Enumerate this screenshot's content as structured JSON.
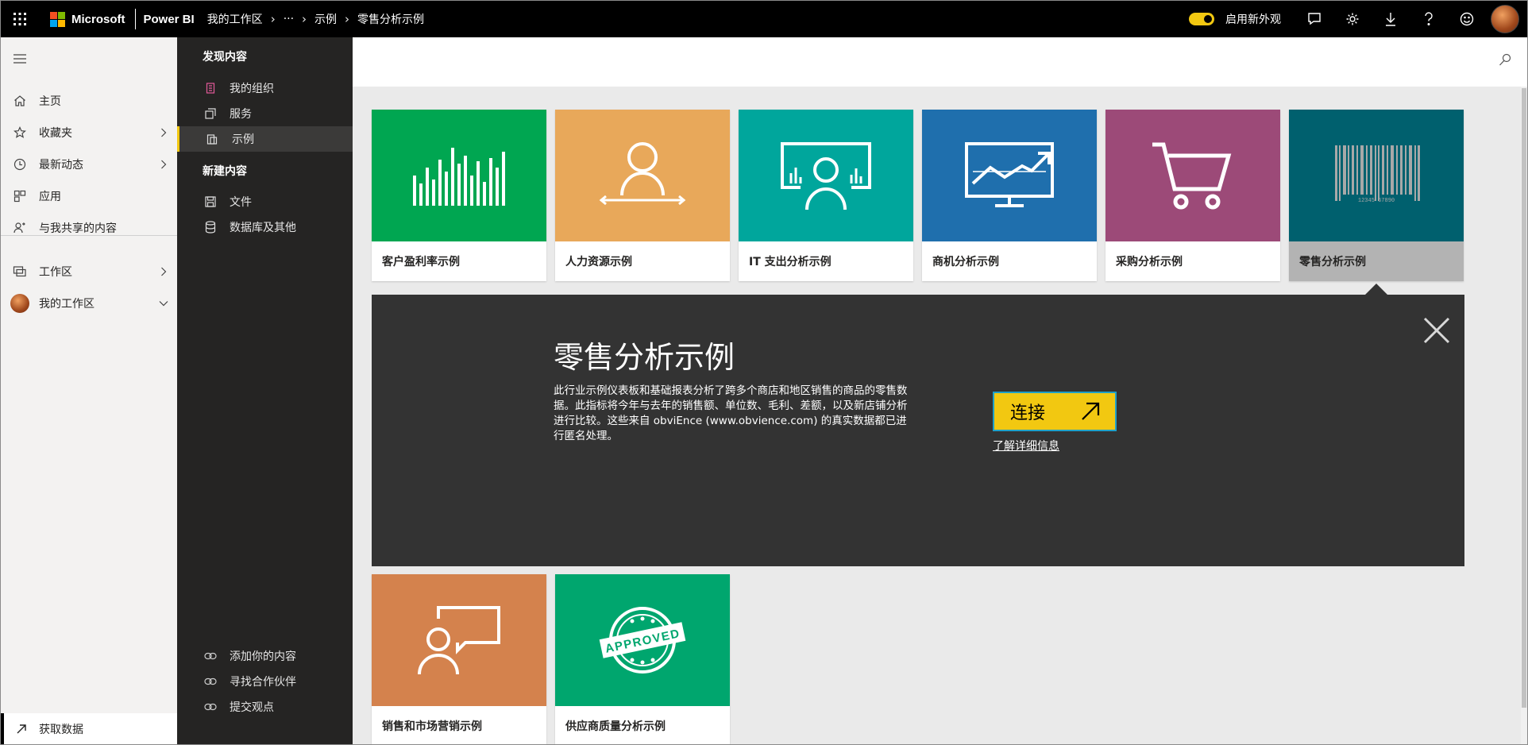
{
  "topbar": {
    "brand": "Microsoft",
    "product": "Power BI",
    "breadcrumbs": [
      "我的工作区",
      "···",
      "示例",
      "零售分析示例"
    ],
    "toggle_label": "启用新外观",
    "accent_color": "#f2c811"
  },
  "leftnav": {
    "items": [
      {
        "label": "主页",
        "icon": "home-icon"
      },
      {
        "label": "收藏夹",
        "icon": "star-icon"
      },
      {
        "label": "最新动态",
        "icon": "clock-icon"
      },
      {
        "label": "应用",
        "icon": "apps-icon"
      },
      {
        "label": "与我共享的内容",
        "icon": "shared-icon"
      },
      {
        "label": "工作区",
        "icon": "workspaces-icon"
      },
      {
        "label": "我的工作区",
        "icon": "avatar"
      }
    ],
    "get_data": "获取数据"
  },
  "panel": {
    "discover_heading": "发现内容",
    "discover_items": [
      "我的组织",
      "服务",
      "示例"
    ],
    "create_heading": "新建内容",
    "create_items": [
      "文件",
      "数据库及其他"
    ],
    "bottom_items": [
      "添加你的内容",
      "寻找合作伙伴",
      "提交观点"
    ]
  },
  "tiles": [
    {
      "caption": "客户盈利率示例",
      "color": "#00a651",
      "icon": "bar-chart-icon"
    },
    {
      "caption": "人力资源示例",
      "color": "#e8a85a",
      "icon": "person-icon"
    },
    {
      "caption": "IT 支出分析示例",
      "color": "#00a69c",
      "icon": "presentation-icon"
    },
    {
      "caption": "商机分析示例",
      "color": "#1f6fad",
      "icon": "monitor-trend-icon"
    },
    {
      "caption": "采购分析示例",
      "color": "#9c4a78",
      "icon": "cart-icon"
    },
    {
      "caption": "零售分析示例",
      "color": "#00606e",
      "icon": "barcode-icon"
    },
    {
      "caption": "销售和市场营销示例",
      "color": "#d4824d",
      "icon": "speech-person-icon"
    },
    {
      "caption": "供应商质量分析示例",
      "color": "#00a66e",
      "icon": "approved-stamp-icon"
    }
  ],
  "detail": {
    "title": "零售分析示例",
    "description": "此行业示例仪表板和基础报表分析了跨多个商店和地区销售的商品的零售数据。此指标将今年与去年的销售额、单位数、毛利、差额，以及新店铺分析进行比较。这些来自 obviEnce (www.obvience.com) 的真实数据都已进行匿名处理。",
    "connect_label": "连接",
    "learn_more": "了解详细信息",
    "barcode_text": "12345    67890"
  },
  "stamp_text": "APPROVED"
}
